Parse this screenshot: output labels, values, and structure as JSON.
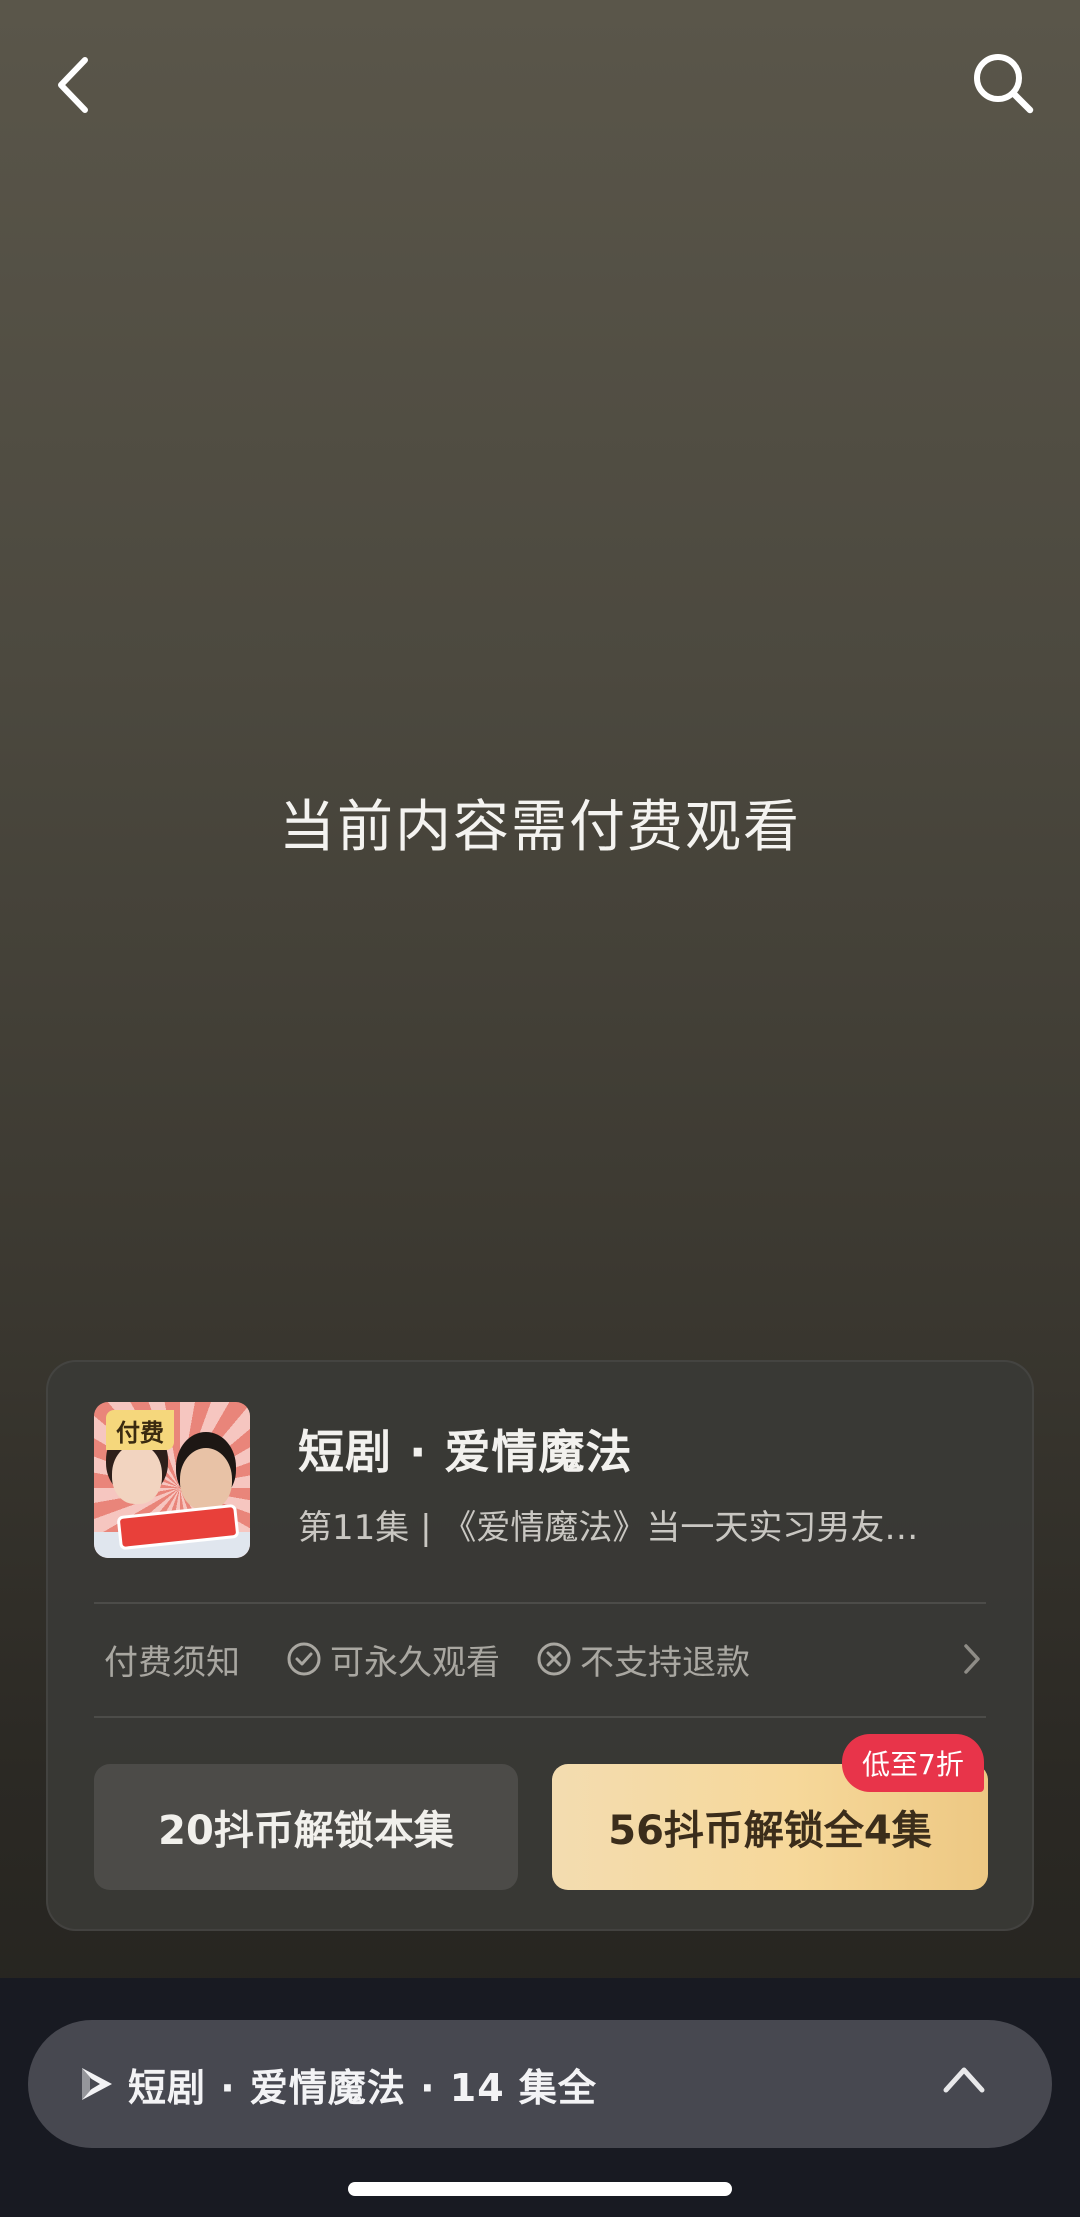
{
  "nav": {
    "back_icon": "chevron-left-icon",
    "search_icon": "search-icon"
  },
  "paywall": {
    "message": "当前内容需付费观看"
  },
  "card": {
    "cover_badge": "付费",
    "title": "短剧 · 爱情魔法",
    "subtitle": "第11集 | 《爱情魔法》当一天实习男友…",
    "notice": {
      "label": "付费须知",
      "items": [
        {
          "icon": "check-circle-icon",
          "text": "可永久观看"
        },
        {
          "icon": "x-circle-icon",
          "text": "不支持退款"
        }
      ]
    },
    "unlock_single_label": "20抖币解锁本集",
    "unlock_all_label": "56抖币解锁全4集",
    "discount_badge": "低至7折",
    "accent_color": "#e8344a"
  },
  "collection_bar": {
    "label": "短剧 · 爱情魔法 · 14 集全",
    "icon": "drama-play-icon",
    "expand_icon": "chevron-up-icon"
  }
}
